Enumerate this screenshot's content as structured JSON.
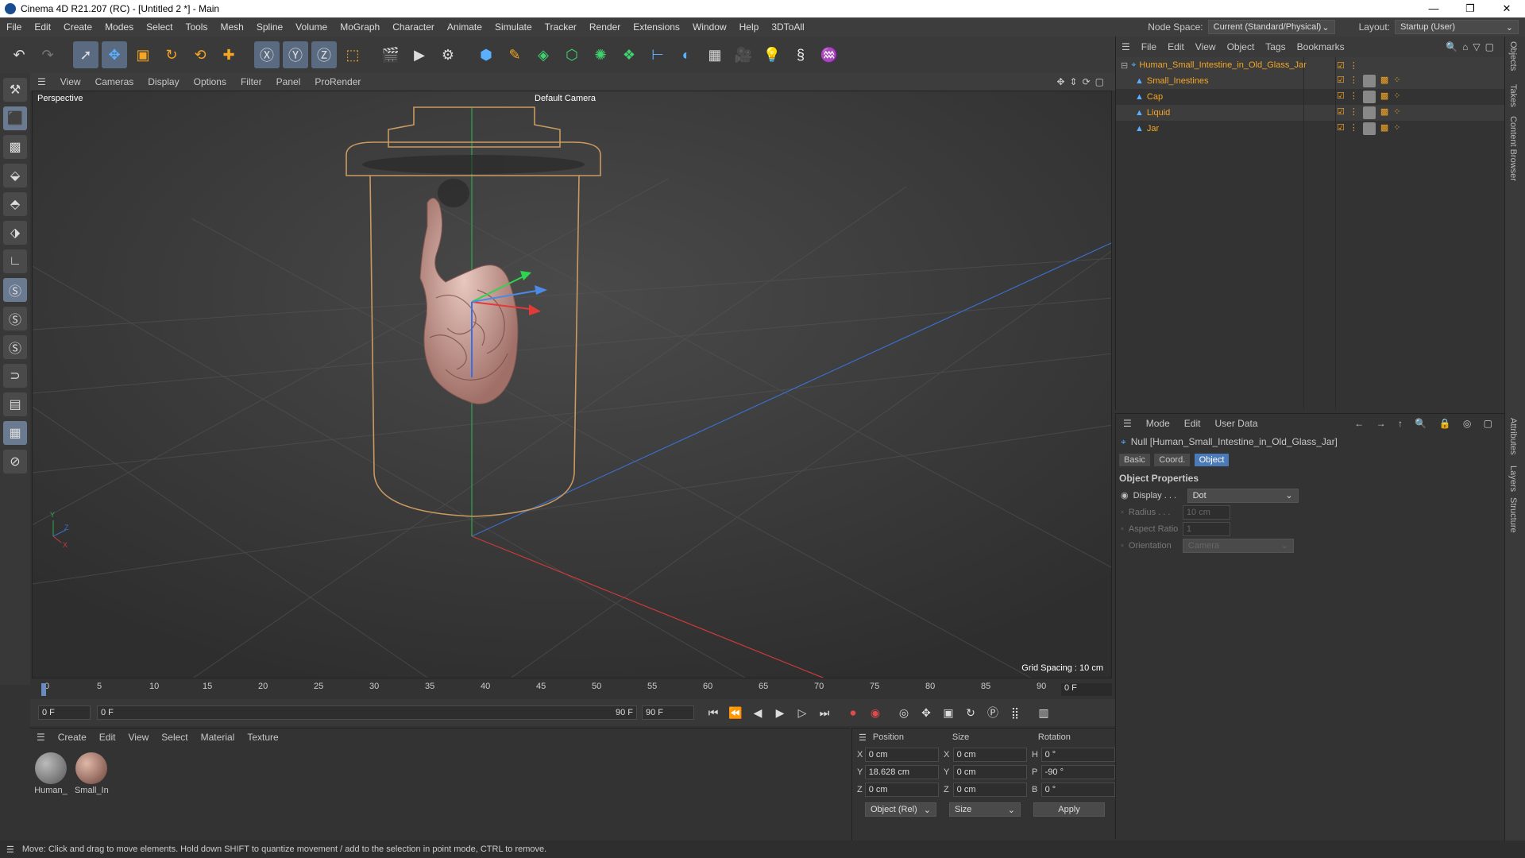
{
  "titlebar": {
    "title": "Cinema 4D R21.207 (RC) - [Untitled 2 *] - Main",
    "minimize": "—",
    "restore": "❐",
    "close": "✕"
  },
  "menubar": {
    "items": [
      "File",
      "Edit",
      "Create",
      "Modes",
      "Select",
      "Tools",
      "Mesh",
      "Spline",
      "Volume",
      "MoGraph",
      "Character",
      "Animate",
      "Simulate",
      "Tracker",
      "Render",
      "Extensions",
      "Window",
      "Help",
      "3DToAll"
    ],
    "node_space_label": "Node Space:",
    "node_space_value": "Current (Standard/Physical)",
    "layout_label": "Layout:",
    "layout_value": "Startup (User)"
  },
  "viewport_menu": [
    "View",
    "Cameras",
    "Display",
    "Options",
    "Filter",
    "Panel",
    "ProRender"
  ],
  "viewport": {
    "label": "Perspective",
    "camera": "Default Camera",
    "grid_spacing": "Grid Spacing : 10 cm"
  },
  "timeline": {
    "ticks": [
      "0",
      "5",
      "10",
      "15",
      "20",
      "25",
      "30",
      "35",
      "40",
      "45",
      "50",
      "55",
      "60",
      "65",
      "70",
      "75",
      "80",
      "85",
      "90"
    ],
    "current_frame": "0 F"
  },
  "transport": {
    "start": "0 F",
    "range_start": "0 F",
    "range_end": "90 F",
    "end": "90 F"
  },
  "material_manager": {
    "menu": [
      "Create",
      "Edit",
      "View",
      "Select",
      "Material",
      "Texture"
    ],
    "materials": [
      {
        "name": "Human_",
        "color": "#8a8a8a"
      },
      {
        "name": "Small_In",
        "color": "#b08070"
      }
    ]
  },
  "coord_manager": {
    "headers": [
      "Position",
      "Size",
      "Rotation"
    ],
    "rows": [
      {
        "axis": "X",
        "pos": "0 cm",
        "saxis": "X",
        "size": "0 cm",
        "raxis": "H",
        "rot": "0 °"
      },
      {
        "axis": "Y",
        "pos": "18.628 cm",
        "saxis": "Y",
        "size": "0 cm",
        "raxis": "P",
        "rot": "-90 °"
      },
      {
        "axis": "Z",
        "pos": "0 cm",
        "saxis": "Z",
        "size": "0 cm",
        "raxis": "B",
        "rot": "0 °"
      }
    ],
    "mode": "Object (Rel)",
    "size_mode": "Size",
    "apply": "Apply"
  },
  "object_manager": {
    "menu": [
      "File",
      "Edit",
      "View",
      "Object",
      "Tags",
      "Bookmarks"
    ],
    "root": "Human_Small_Intestine_in_Old_Glass_Jar",
    "children": [
      "Small_Inestines",
      "Cap",
      "Liquid",
      "Jar"
    ]
  },
  "attribute_manager": {
    "menu": [
      "Mode",
      "Edit",
      "User Data"
    ],
    "object_title": "Null [Human_Small_Intestine_in_Old_Glass_Jar]",
    "tabs": [
      "Basic",
      "Coord.",
      "Object"
    ],
    "section": "Object Properties",
    "props": [
      {
        "label": "Display . . .",
        "value": "Dot",
        "enabled": true
      },
      {
        "label": "Radius . . .",
        "value": "10 cm",
        "enabled": false
      },
      {
        "label": "Aspect Ratio",
        "value": "1",
        "enabled": false
      },
      {
        "label": "Orientation",
        "value": "Camera",
        "enabled": false
      }
    ]
  },
  "right_strip": [
    "Objects",
    "Takes",
    "Content Browser",
    "Attributes",
    "Layers",
    "Structure"
  ],
  "status": "Move: Click and drag to move elements. Hold down SHIFT to quantize movement / add to the selection in point mode, CTRL to remove."
}
